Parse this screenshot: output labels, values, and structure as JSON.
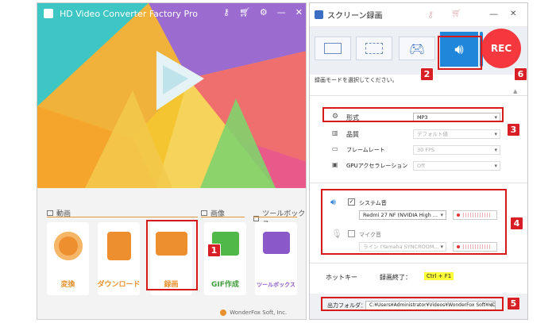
{
  "main_window": {
    "title": "HD Video Converter Factory Pro",
    "sections": {
      "video": "動画",
      "image": "画像",
      "toolbox": "ツールボックス"
    },
    "tiles": [
      {
        "label": "変換"
      },
      {
        "label": "ダウンロード"
      },
      {
        "label": "録画"
      },
      {
        "label": "GIF作成"
      },
      {
        "label": "ツールボックス"
      }
    ],
    "footer": "WonderFox Soft, Inc."
  },
  "recorder": {
    "title": "スクリーン録画",
    "rec_label": "REC",
    "mode_hint": "録画モードを選択してください。",
    "settings": {
      "format_label": "形式",
      "format_value": "MP3",
      "quality_label": "品質",
      "quality_value": "デフォルト値",
      "framerate_label": "フレームレート",
      "framerate_value": "30 FPS",
      "gpu_label": "GPUアクセラレーション",
      "gpu_value": "Off"
    },
    "audio": {
      "system_label": "システム音",
      "system_device": "Redmi 27 NF (NVIDIA High ...",
      "mic_label": "マイク音",
      "mic_device": "ライン (Yamaha SYNCROOM..."
    },
    "hotkey_label": "ホットキー",
    "end_label": "録画終了：",
    "end_key": "Ctrl + F1",
    "output_label": "出力フォルダ：",
    "output_path": "C:¥Users¥Administrator¥Videos¥WonderFox Soft¥HD V"
  },
  "badges": [
    "1",
    "2",
    "3",
    "4",
    "5",
    "6"
  ],
  "colors": {
    "accent": "#e8912f",
    "highlight": "#d61a1a",
    "rec": "#f5383d",
    "audio_mode": "#1f86d9"
  }
}
